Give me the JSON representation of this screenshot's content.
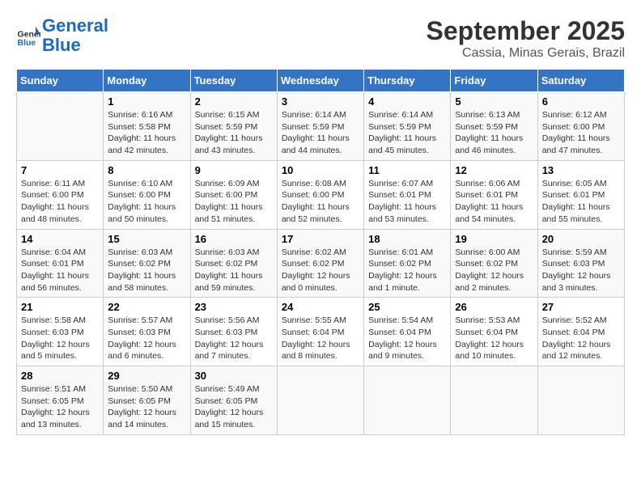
{
  "header": {
    "logo_line1": "General",
    "logo_line2": "Blue",
    "month": "September 2025",
    "location": "Cassia, Minas Gerais, Brazil"
  },
  "days_of_week": [
    "Sunday",
    "Monday",
    "Tuesday",
    "Wednesday",
    "Thursday",
    "Friday",
    "Saturday"
  ],
  "weeks": [
    [
      {
        "day": "",
        "info": ""
      },
      {
        "day": "1",
        "info": "Sunrise: 6:16 AM\nSunset: 5:58 PM\nDaylight: 11 hours and 42 minutes."
      },
      {
        "day": "2",
        "info": "Sunrise: 6:15 AM\nSunset: 5:59 PM\nDaylight: 11 hours and 43 minutes."
      },
      {
        "day": "3",
        "info": "Sunrise: 6:14 AM\nSunset: 5:59 PM\nDaylight: 11 hours and 44 minutes."
      },
      {
        "day": "4",
        "info": "Sunrise: 6:14 AM\nSunset: 5:59 PM\nDaylight: 11 hours and 45 minutes."
      },
      {
        "day": "5",
        "info": "Sunrise: 6:13 AM\nSunset: 5:59 PM\nDaylight: 11 hours and 46 minutes."
      },
      {
        "day": "6",
        "info": "Sunrise: 6:12 AM\nSunset: 6:00 PM\nDaylight: 11 hours and 47 minutes."
      }
    ],
    [
      {
        "day": "7",
        "info": "Sunrise: 6:11 AM\nSunset: 6:00 PM\nDaylight: 11 hours and 48 minutes."
      },
      {
        "day": "8",
        "info": "Sunrise: 6:10 AM\nSunset: 6:00 PM\nDaylight: 11 hours and 50 minutes."
      },
      {
        "day": "9",
        "info": "Sunrise: 6:09 AM\nSunset: 6:00 PM\nDaylight: 11 hours and 51 minutes."
      },
      {
        "day": "10",
        "info": "Sunrise: 6:08 AM\nSunset: 6:00 PM\nDaylight: 11 hours and 52 minutes."
      },
      {
        "day": "11",
        "info": "Sunrise: 6:07 AM\nSunset: 6:01 PM\nDaylight: 11 hours and 53 minutes."
      },
      {
        "day": "12",
        "info": "Sunrise: 6:06 AM\nSunset: 6:01 PM\nDaylight: 11 hours and 54 minutes."
      },
      {
        "day": "13",
        "info": "Sunrise: 6:05 AM\nSunset: 6:01 PM\nDaylight: 11 hours and 55 minutes."
      }
    ],
    [
      {
        "day": "14",
        "info": "Sunrise: 6:04 AM\nSunset: 6:01 PM\nDaylight: 11 hours and 56 minutes."
      },
      {
        "day": "15",
        "info": "Sunrise: 6:03 AM\nSunset: 6:02 PM\nDaylight: 11 hours and 58 minutes."
      },
      {
        "day": "16",
        "info": "Sunrise: 6:03 AM\nSunset: 6:02 PM\nDaylight: 11 hours and 59 minutes."
      },
      {
        "day": "17",
        "info": "Sunrise: 6:02 AM\nSunset: 6:02 PM\nDaylight: 12 hours and 0 minutes."
      },
      {
        "day": "18",
        "info": "Sunrise: 6:01 AM\nSunset: 6:02 PM\nDaylight: 12 hours and 1 minute."
      },
      {
        "day": "19",
        "info": "Sunrise: 6:00 AM\nSunset: 6:02 PM\nDaylight: 12 hours and 2 minutes."
      },
      {
        "day": "20",
        "info": "Sunrise: 5:59 AM\nSunset: 6:03 PM\nDaylight: 12 hours and 3 minutes."
      }
    ],
    [
      {
        "day": "21",
        "info": "Sunrise: 5:58 AM\nSunset: 6:03 PM\nDaylight: 12 hours and 5 minutes."
      },
      {
        "day": "22",
        "info": "Sunrise: 5:57 AM\nSunset: 6:03 PM\nDaylight: 12 hours and 6 minutes."
      },
      {
        "day": "23",
        "info": "Sunrise: 5:56 AM\nSunset: 6:03 PM\nDaylight: 12 hours and 7 minutes."
      },
      {
        "day": "24",
        "info": "Sunrise: 5:55 AM\nSunset: 6:04 PM\nDaylight: 12 hours and 8 minutes."
      },
      {
        "day": "25",
        "info": "Sunrise: 5:54 AM\nSunset: 6:04 PM\nDaylight: 12 hours and 9 minutes."
      },
      {
        "day": "26",
        "info": "Sunrise: 5:53 AM\nSunset: 6:04 PM\nDaylight: 12 hours and 10 minutes."
      },
      {
        "day": "27",
        "info": "Sunrise: 5:52 AM\nSunset: 6:04 PM\nDaylight: 12 hours and 12 minutes."
      }
    ],
    [
      {
        "day": "28",
        "info": "Sunrise: 5:51 AM\nSunset: 6:05 PM\nDaylight: 12 hours and 13 minutes."
      },
      {
        "day": "29",
        "info": "Sunrise: 5:50 AM\nSunset: 6:05 PM\nDaylight: 12 hours and 14 minutes."
      },
      {
        "day": "30",
        "info": "Sunrise: 5:49 AM\nSunset: 6:05 PM\nDaylight: 12 hours and 15 minutes."
      },
      {
        "day": "",
        "info": ""
      },
      {
        "day": "",
        "info": ""
      },
      {
        "day": "",
        "info": ""
      },
      {
        "day": "",
        "info": ""
      }
    ]
  ]
}
